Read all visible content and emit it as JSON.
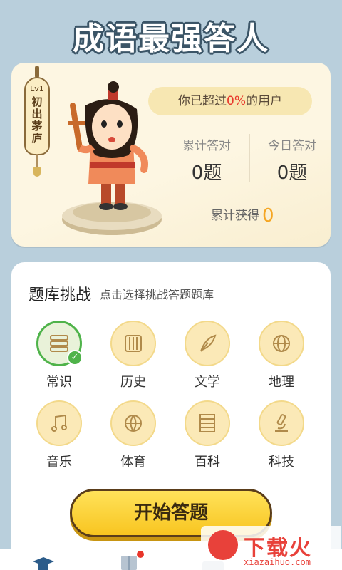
{
  "header": {
    "title": "成语最强答人"
  },
  "profile": {
    "level": "Lv1",
    "rank": "初出茅庐",
    "beat_prefix": "你已超过",
    "beat_percent": "0%",
    "beat_suffix": "的用户",
    "total_correct_label": "累计答对",
    "total_correct_value": "0题",
    "today_correct_label": "今日答对",
    "today_correct_value": "0题",
    "gained_label": "累计获得",
    "gained_value": "0"
  },
  "challenge": {
    "title": "题库挑战",
    "subtitle": "点击选择挑战答题题库",
    "categories": [
      {
        "label": "常识",
        "icon": "books-icon",
        "selected": true
      },
      {
        "label": "历史",
        "icon": "scroll-icon",
        "selected": false
      },
      {
        "label": "文学",
        "icon": "quill-icon",
        "selected": false
      },
      {
        "label": "地理",
        "icon": "globe-icon",
        "selected": false
      },
      {
        "label": "音乐",
        "icon": "music-note-icon",
        "selected": false
      },
      {
        "label": "体育",
        "icon": "basketball-icon",
        "selected": false
      },
      {
        "label": "百科",
        "icon": "abacus-icon",
        "selected": false
      },
      {
        "label": "科技",
        "icon": "microscope-icon",
        "selected": false
      }
    ],
    "start_button": "开始答题"
  },
  "watermark": {
    "text": "下载火",
    "url": "xiazaihuo.com"
  },
  "colors": {
    "accent": "#f8c520",
    "selected": "#4fb34a",
    "highlight": "#e8352a"
  }
}
